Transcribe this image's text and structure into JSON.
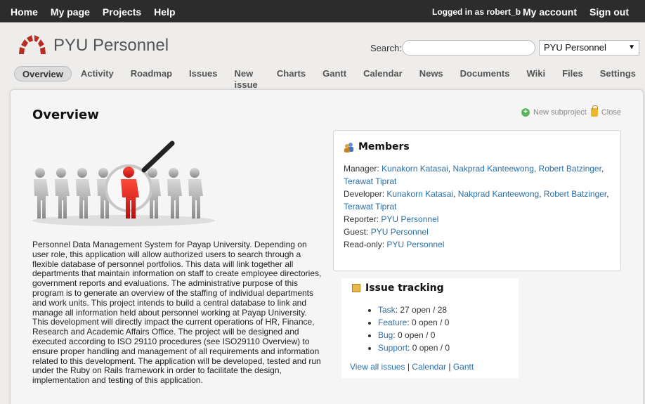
{
  "top_menu": {
    "items": [
      "Home",
      "My page",
      "Projects",
      "Help"
    ],
    "logged_as_prefix": "Logged in as ",
    "user": "robert_b",
    "my_account": "My account",
    "sign_out": "Sign out"
  },
  "header": {
    "project_title": "PYU Personnel",
    "search_label": "Search:",
    "search_value": "",
    "project_jump": "PYU Personnel"
  },
  "main_menu": {
    "tabs": [
      "Overview",
      "Activity",
      "Roadmap",
      "Issues",
      "New issue",
      "Charts",
      "Gantt",
      "Calendar",
      "News",
      "Documents",
      "Wiki",
      "Files",
      "Settings"
    ],
    "selected": "Overview"
  },
  "content": {
    "title": "Overview",
    "new_subproject": "New subproject",
    "close": "Close",
    "description": "Personnel Data Management System for Payap University. Depending on user role, this application will allow authorized users to search through a flexible database of personnel portfolios. This data will link together all departments that maintain information on staff to create employee directories, government reports and evaluations. The administrative purpose of this program is to generate an overview of the staffing of individual departments and work units. This project intends to build a central database to link and manage all information held about personnel working at Payap University. This development will directly impact the current operations of HR, Finance, Research and Academic Affairs Office. The project will be designed and executed according to ISO 29110 procedures (see ISO29110 Overview) to ensure proper handling and management of all requirements and information related to this development. The application will be developed, tested and run under the Ruby on Rails framework in order to facilitate the design, implementation and testing of this application."
  },
  "members": {
    "title": "Members",
    "manager_label": "Manager:",
    "manager": [
      "Kunakorn Katasai",
      "Nakprad Kanteewong",
      "Robert Batzinger",
      "Terawat Tiprat"
    ],
    "developer_label": "Developer:",
    "developer": [
      "Kunakorn Katasai",
      "Nakprad Kanteewong",
      "Robert Batzinger",
      "Terawat Tiprat"
    ],
    "reporter_label": "Reporter:",
    "reporter": "PYU Personnel",
    "guest_label": "Guest:",
    "guest": "PYU Personnel",
    "readonly_label": "Read-only:",
    "readonly": "PYU Personnel"
  },
  "issue_tracking": {
    "title": "Issue tracking",
    "trackers": [
      {
        "name": "Task",
        "stats": ": 27 open / 28"
      },
      {
        "name": "Feature",
        "stats": ": 0 open / 0"
      },
      {
        "name": "Bug",
        "stats": ": 0 open / 0"
      },
      {
        "name": "Support",
        "stats": ": 0 open / 0"
      }
    ],
    "view_all": "View all issues",
    "calendar": "Calendar",
    "gantt": "Gantt",
    "separator": "|"
  },
  "colors": {
    "link": "#2a6fa8",
    "top_bar": "#2c2c2c",
    "logo_red": "#b92d20",
    "highlight_red": "#d21a1a"
  }
}
